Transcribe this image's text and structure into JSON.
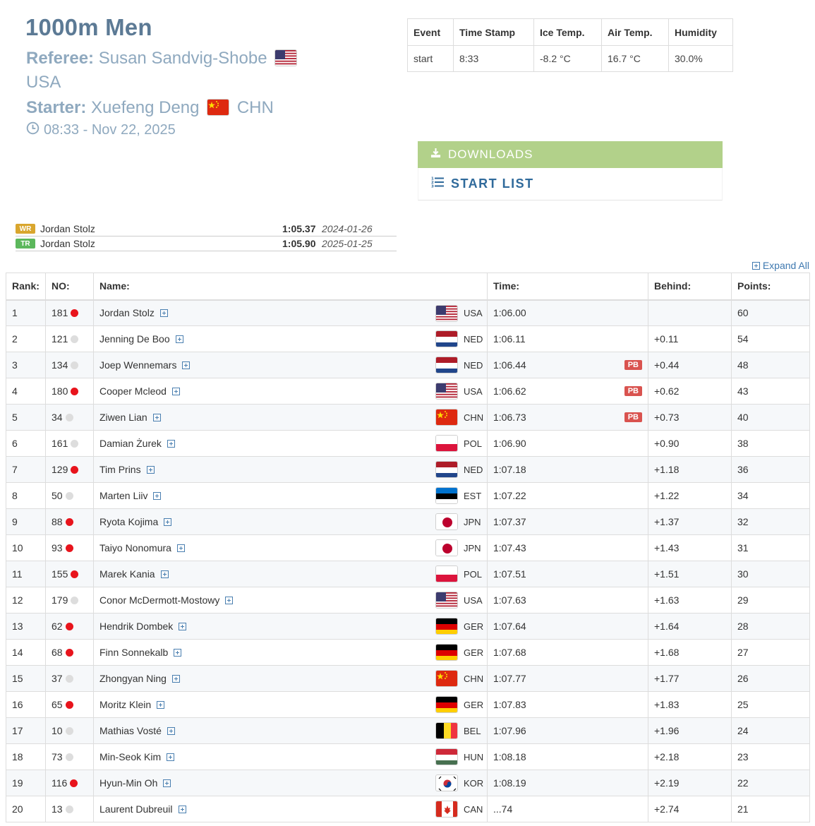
{
  "header": {
    "title": "1000m Men",
    "referee_label": "Referee:",
    "referee_name": "Susan Sandvig-Shobe",
    "referee_nation": "USA",
    "starter_label": "Starter:",
    "starter_name": "Xuefeng Deng",
    "starter_nation": "CHN",
    "datetime": "08:33 - Nov 22, 2025",
    "clock_icon": "clock-icon"
  },
  "conditions": {
    "headers": [
      "Event",
      "Time Stamp",
      "Ice Temp.",
      "Air Temp.",
      "Humidity"
    ],
    "row": [
      "start",
      "8:33",
      "-8.2 °C",
      "16.7 °C",
      "30.0%"
    ]
  },
  "downloads": {
    "label": "DOWNLOADS",
    "icon": "download-icon"
  },
  "start_list": {
    "label": "START LIST",
    "icon": "numbered-list-icon"
  },
  "records": [
    {
      "badge": "WR",
      "color": "#d9a62e",
      "name": "Jordan Stolz",
      "time": "1:05.37",
      "date": "2024-01-26"
    },
    {
      "badge": "TR",
      "color": "#5cb85c",
      "name": "Jordan Stolz",
      "time": "1:05.90",
      "date": "2025-01-25"
    }
  ],
  "expand_all": "Expand All",
  "results": {
    "headers": {
      "rank": "Rank:",
      "no": "NO:",
      "name": "Name:",
      "time": "Time:",
      "behind": "Behind:",
      "points": "Points:"
    },
    "dot_colors": {
      "red": "#e8141c",
      "grey": "#dddddd"
    },
    "rows": [
      {
        "rank": "1",
        "no": "181",
        "dot": "red",
        "name": "Jordan Stolz",
        "nation": "USA",
        "time": "1:06.00",
        "pb": "",
        "behind": "",
        "points": "60"
      },
      {
        "rank": "2",
        "no": "121",
        "dot": "grey",
        "name": "Jenning De Boo",
        "nation": "NED",
        "time": "1:06.11",
        "pb": "",
        "behind": "+0.11",
        "points": "54"
      },
      {
        "rank": "3",
        "no": "134",
        "dot": "grey",
        "name": "Joep Wennemars",
        "nation": "NED",
        "time": "1:06.44",
        "pb": "PB",
        "behind": "+0.44",
        "points": "48"
      },
      {
        "rank": "4",
        "no": "180",
        "dot": "red",
        "name": "Cooper Mcleod",
        "nation": "USA",
        "time": "1:06.62",
        "pb": "PB",
        "behind": "+0.62",
        "points": "43"
      },
      {
        "rank": "5",
        "no": "34",
        "dot": "grey",
        "name": "Ziwen Lian",
        "nation": "CHN",
        "time": "1:06.73",
        "pb": "PB",
        "behind": "+0.73",
        "points": "40"
      },
      {
        "rank": "6",
        "no": "161",
        "dot": "grey",
        "name": "Damian Żurek",
        "nation": "POL",
        "time": "1:06.90",
        "pb": "",
        "behind": "+0.90",
        "points": "38"
      },
      {
        "rank": "7",
        "no": "129",
        "dot": "red",
        "name": "Tim Prins",
        "nation": "NED",
        "time": "1:07.18",
        "pb": "",
        "behind": "+1.18",
        "points": "36"
      },
      {
        "rank": "8",
        "no": "50",
        "dot": "grey",
        "name": "Marten Liiv",
        "nation": "EST",
        "time": "1:07.22",
        "pb": "",
        "behind": "+1.22",
        "points": "34"
      },
      {
        "rank": "9",
        "no": "88",
        "dot": "red",
        "name": "Ryota Kojima",
        "nation": "JPN",
        "time": "1:07.37",
        "pb": "",
        "behind": "+1.37",
        "points": "32"
      },
      {
        "rank": "10",
        "no": "93",
        "dot": "red",
        "name": "Taiyo Nonomura",
        "nation": "JPN",
        "time": "1:07.43",
        "pb": "",
        "behind": "+1.43",
        "points": "31"
      },
      {
        "rank": "11",
        "no": "155",
        "dot": "red",
        "name": "Marek Kania",
        "nation": "POL",
        "time": "1:07.51",
        "pb": "",
        "behind": "+1.51",
        "points": "30"
      },
      {
        "rank": "12",
        "no": "179",
        "dot": "grey",
        "name": "Conor McDermott-Mostowy",
        "nation": "USA",
        "time": "1:07.63",
        "pb": "",
        "behind": "+1.63",
        "points": "29"
      },
      {
        "rank": "13",
        "no": "62",
        "dot": "red",
        "name": "Hendrik Dombek",
        "nation": "GER",
        "time": "1:07.64",
        "pb": "",
        "behind": "+1.64",
        "points": "28"
      },
      {
        "rank": "14",
        "no": "68",
        "dot": "red",
        "name": "Finn Sonnekalb",
        "nation": "GER",
        "time": "1:07.68",
        "pb": "",
        "behind": "+1.68",
        "points": "27"
      },
      {
        "rank": "15",
        "no": "37",
        "dot": "grey",
        "name": "Zhongyan Ning",
        "nation": "CHN",
        "time": "1:07.77",
        "pb": "",
        "behind": "+1.77",
        "points": "26"
      },
      {
        "rank": "16",
        "no": "65",
        "dot": "red",
        "name": "Moritz Klein",
        "nation": "GER",
        "time": "1:07.83",
        "pb": "",
        "behind": "+1.83",
        "points": "25"
      },
      {
        "rank": "17",
        "no": "10",
        "dot": "grey",
        "name": "Mathias Vosté",
        "nation": "BEL",
        "time": "1:07.96",
        "pb": "",
        "behind": "+1.96",
        "points": "24"
      },
      {
        "rank": "18",
        "no": "73",
        "dot": "grey",
        "name": "Min-Seok Kim",
        "nation": "HUN",
        "time": "1:08.18",
        "pb": "",
        "behind": "+2.18",
        "points": "23"
      },
      {
        "rank": "19",
        "no": "116",
        "dot": "red",
        "name": "Hyun-Min Oh",
        "nation": "KOR",
        "time": "1:08.19",
        "pb": "",
        "behind": "+2.19",
        "points": "22"
      },
      {
        "rank": "20",
        "no": "13",
        "dot": "grey",
        "name": "Laurent Dubreuil",
        "nation": "CAN",
        "time": "...74",
        "pb": "",
        "behind": "+2.74",
        "points": "21"
      }
    ]
  }
}
